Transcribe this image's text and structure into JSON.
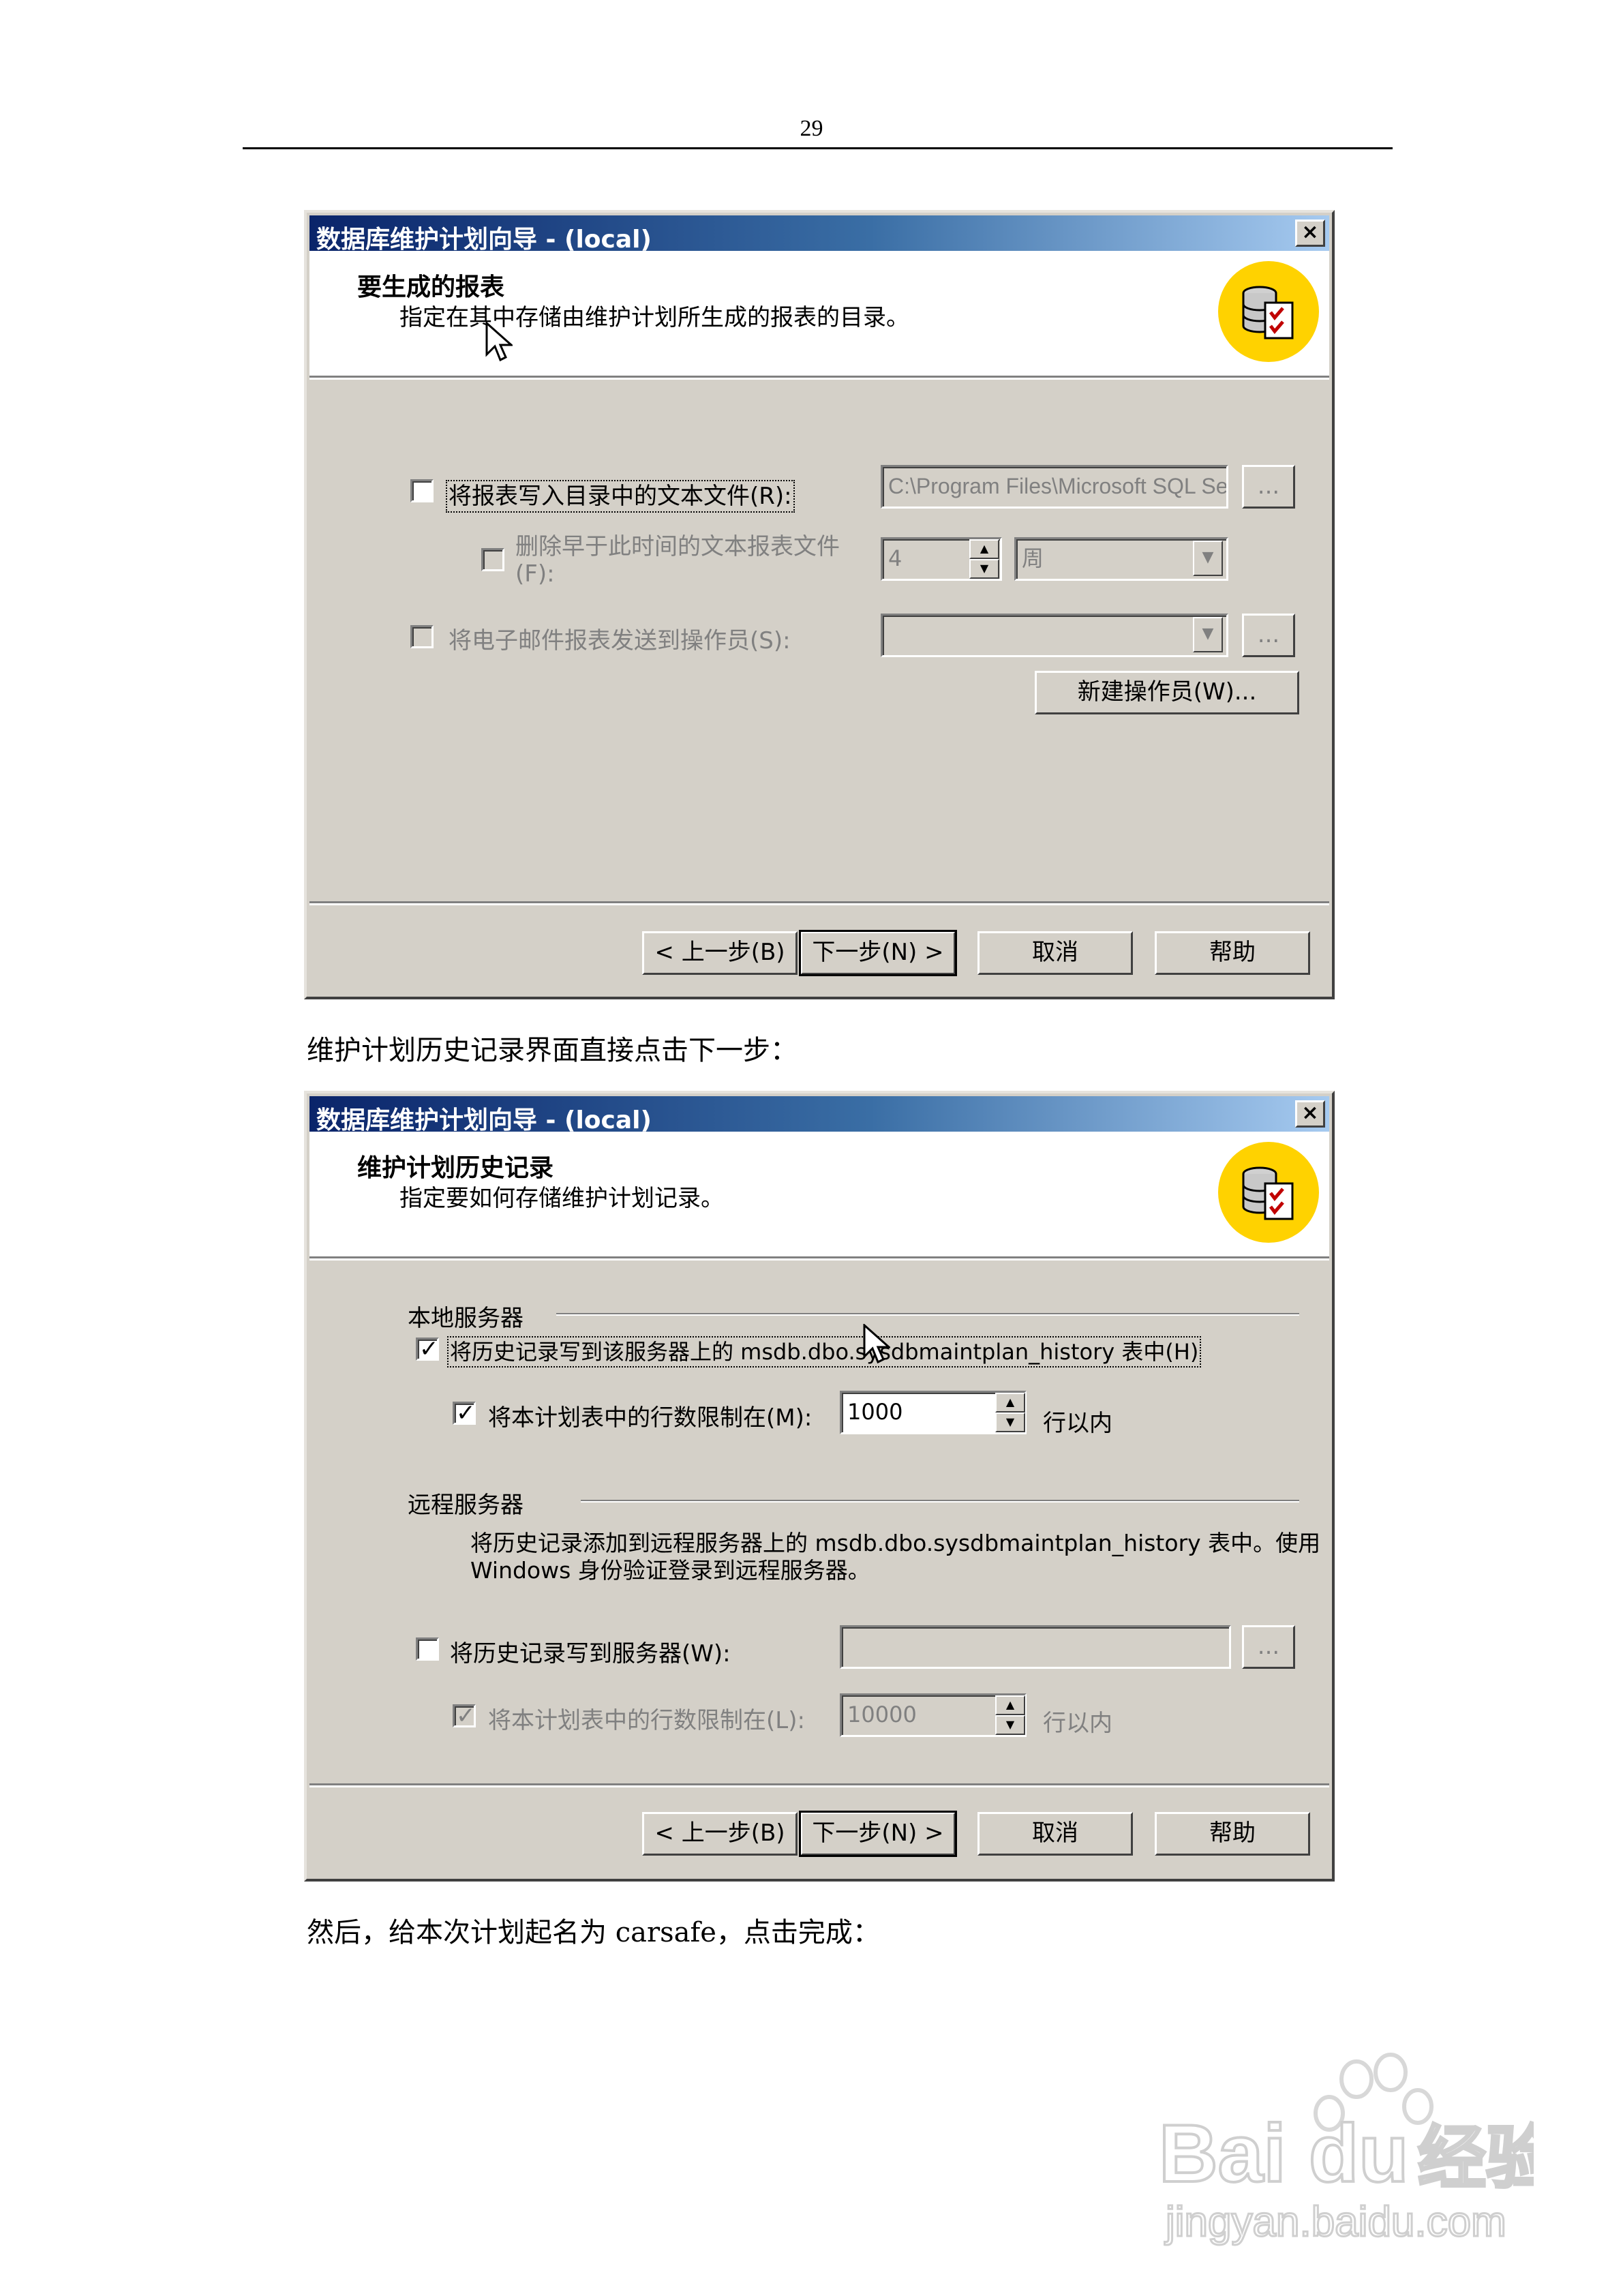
{
  "page": {
    "page_number": "29",
    "caption_1": "维护计划历史记录界面直接点击下一步：",
    "caption_2": "然后，给本次计划起名为 carsafe，点击完成："
  },
  "dialog_1": {
    "title": "数据库维护计划向导 - (local)",
    "close_label": "×",
    "step_title": "要生成的报表",
    "step_description": "指定在其中存储由维护计划所生成的报表的目录。",
    "write_report_label": "将报表写入目录中的文本文件(R):",
    "write_report_checked": false,
    "report_path": "C:\\Program Files\\Microsoft SQL Se",
    "browse_label": "...",
    "delete_older_label_line1": "删除早于此时间的文本报表文件",
    "delete_older_label_line2": "(F):",
    "delete_older_checked": false,
    "delete_older_value": "4",
    "delete_older_unit": "周",
    "email_report_label": "将电子邮件报表发送到操作员(S):",
    "email_report_checked": false,
    "operator_value": "",
    "new_operator_label": "新建操作员(W)...",
    "buttons": {
      "back": "< 上一步(B)",
      "next": "下一步(N) >",
      "cancel": "取消",
      "help": "帮助"
    }
  },
  "dialog_2": {
    "title": "数据库维护计划向导 - (local)",
    "close_label": "×",
    "step_title": "维护计划历史记录",
    "step_description": "指定要如何存储维护计划记录。",
    "local_group": "本地服务器",
    "local_history_label": "将历史记录写到该服务器上的 msdb.dbo.sysdbmaintplan_history 表中(H)",
    "local_history_checked": true,
    "local_limit_label": "将本计划表中的行数限制在(M):",
    "local_limit_checked": true,
    "local_limit_value": "1000",
    "local_limit_suffix": "行以内",
    "remote_group": "远程服务器",
    "remote_desc_line1": "将历史记录添加到远程服务器上的 msdb.dbo.sysdbmaintplan_history 表中。使用",
    "remote_desc_line2": "Windows 身份验证登录到远程服务器。",
    "remote_history_label": "将历史记录写到服务器(W):",
    "remote_history_checked": false,
    "remote_server_value": "",
    "browse_label": "...",
    "remote_limit_label": "将本计划表中的行数限制在(L):",
    "remote_limit_checked": true,
    "remote_limit_value": "10000",
    "remote_limit_suffix": "行以内",
    "buttons": {
      "back": "< 上一步(B)",
      "next": "下一步(N) >",
      "cancel": "取消",
      "help": "帮助"
    }
  },
  "watermark": {
    "line1": "Bai",
    "line2": "du",
    "line3": "经验",
    "line4": "jingyan.baidu.com"
  },
  "colors": {
    "face": "#d4d0c8",
    "title_start": "#0a246a",
    "title_end": "#a6caf0",
    "logo_yellow": "#ffd200"
  }
}
